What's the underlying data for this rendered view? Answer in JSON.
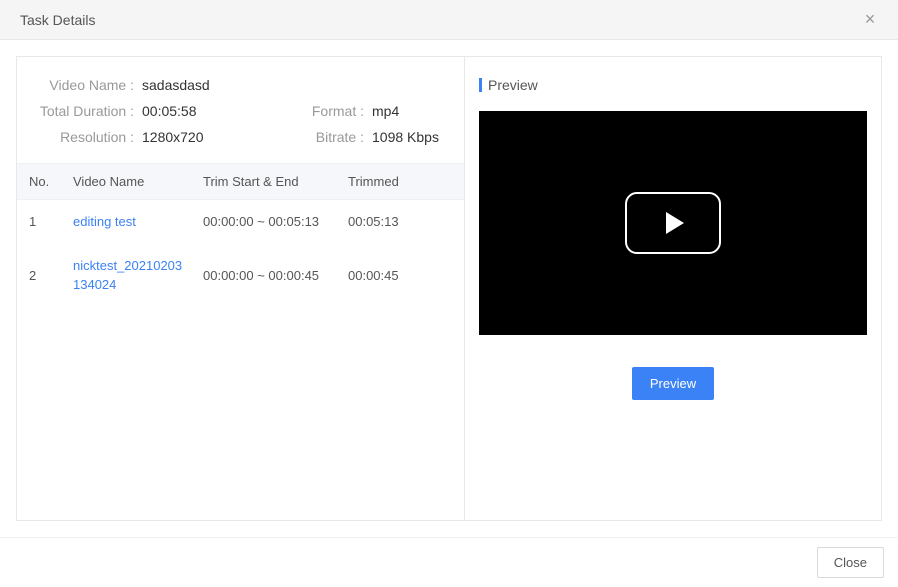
{
  "header": {
    "title": "Task Details",
    "close_icon": "×"
  },
  "meta": {
    "video_name_label": "Video Name :",
    "video_name_value": "sadasdasd",
    "total_duration_label": "Total Duration :",
    "total_duration_value": "00:05:58",
    "format_label": "Format :",
    "format_value": "mp4",
    "resolution_label": "Resolution :",
    "resolution_value": "1280x720",
    "bitrate_label": "Bitrate :",
    "bitrate_value": "1098  Kbps"
  },
  "table": {
    "headers": {
      "no": "No.",
      "video_name": "Video Name",
      "trim": "Trim Start & End",
      "trimmed": "Trimmed"
    },
    "rows": [
      {
        "no": "1",
        "video_name": "editing test",
        "trim": "00:00:00 ~ 00:05:13",
        "trimmed": "00:05:13"
      },
      {
        "no": "2",
        "video_name": "nicktest_20210203134024",
        "trim": "00:00:00 ~ 00:00:45",
        "trimmed": "00:00:45"
      }
    ]
  },
  "preview": {
    "heading": "Preview",
    "button": "Preview"
  },
  "footer": {
    "close": "Close"
  }
}
